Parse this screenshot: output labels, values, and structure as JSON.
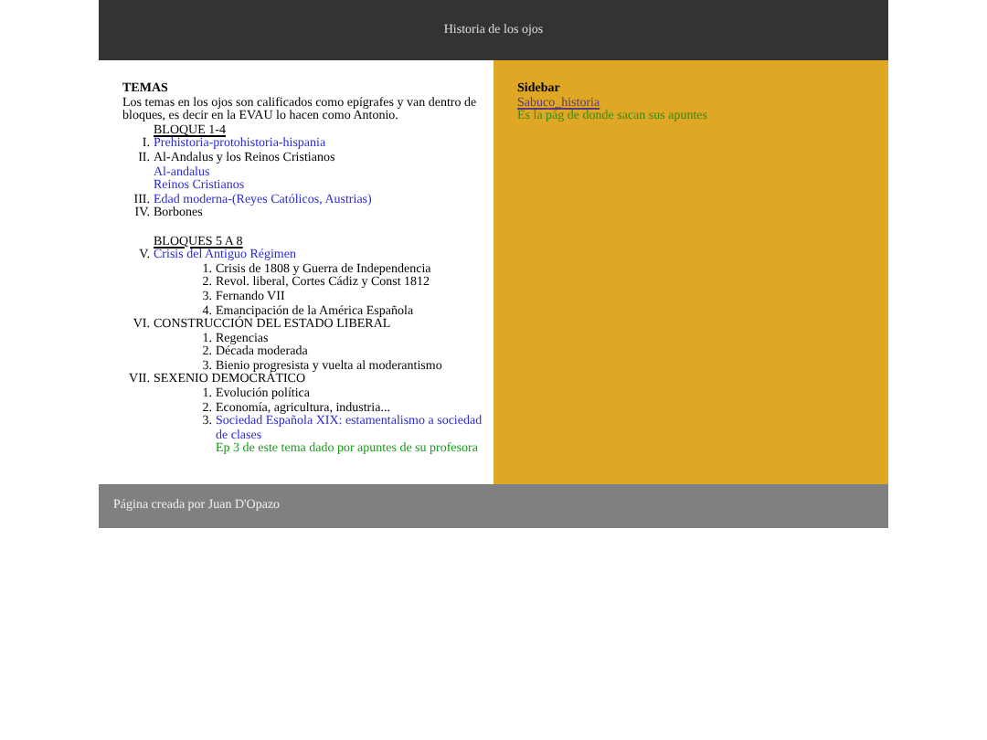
{
  "header": {
    "title": "Historia de los ojos"
  },
  "content": {
    "title": "TEMAS",
    "intro": "Los temas en los ojos son calificados como epígrafes y van dentro de bloques, es decir en la EVAU lo hacen como Antonio.",
    "blocks": [
      {
        "heading": "BLOQUE 1-4",
        "items": [
          {
            "marker": "I.",
            "text": "Prehistoria-protohistoria-hispania",
            "link": true
          },
          {
            "marker": "II.",
            "text": "Al-Andalus y los Reinos Cristianos",
            "link": false,
            "children": [
              {
                "kind": "plain",
                "text": "Al-andalus",
                "link": true
              },
              {
                "kind": "plain",
                "text": "Reinos Cristianos",
                "link": true
              }
            ]
          },
          {
            "marker": "III.",
            "text": "Edad moderna-(Reyes Católicos, Austrias)",
            "link": true
          },
          {
            "marker": "IV.",
            "text": "Borbones",
            "link": false
          }
        ]
      },
      {
        "heading": "BLOQUES 5 A 8",
        "items": [
          {
            "marker": "V.",
            "text": "Crisis del Antiguo Régimen",
            "link": true,
            "children": [
              {
                "kind": "numbered",
                "marker": "1.",
                "text": "Crisis de 1808 y Guerra de Independencia",
                "link": false
              },
              {
                "kind": "numbered",
                "marker": "2.",
                "text": "Revol. liberal, Cortes Cádiz y Const 1812",
                "link": false
              },
              {
                "kind": "numbered",
                "marker": "3.",
                "text": "Fernando VII",
                "link": false
              },
              {
                "kind": "numbered",
                "marker": "4.",
                "text": "Emancipación de la América Española",
                "link": false
              }
            ]
          },
          {
            "marker": "VI.",
            "text": "CONSTRUCCIÓN DEL ESTADO LIBERAL",
            "link": false,
            "children": [
              {
                "kind": "numbered",
                "marker": "1.",
                "text": "Regencias",
                "link": false
              },
              {
                "kind": "numbered",
                "marker": "2.",
                "text": "Década moderada",
                "link": false
              },
              {
                "kind": "numbered",
                "marker": "3.",
                "text": "Bienio progresista y vuelta al moderantismo",
                "link": false
              }
            ]
          },
          {
            "marker": "VII.",
            "text": "SEXENIO DEMOCRÁTICO",
            "link": false,
            "children": [
              {
                "kind": "numbered",
                "marker": "1.",
                "text": "Evolución política",
                "link": false
              },
              {
                "kind": "numbered",
                "marker": "2.",
                "text": "Economía, agricultura, industria...",
                "link": false
              },
              {
                "kind": "numbered",
                "marker": "3.",
                "text": "Sociedad Española XIX: estamentalismo a sociedad de clases",
                "link": true
              },
              {
                "kind": "note",
                "text": "Ep 3 de este tema dado por apuntes de su profesora",
                "link": false
              }
            ]
          }
        ]
      }
    ]
  },
  "sidebar": {
    "title": "Sidebar",
    "link": "Sabuco_historia",
    "note": "Es la pág de donde sacan sus apuntes"
  },
  "footer": {
    "text": "Página creada por Juan D'Opazo"
  }
}
